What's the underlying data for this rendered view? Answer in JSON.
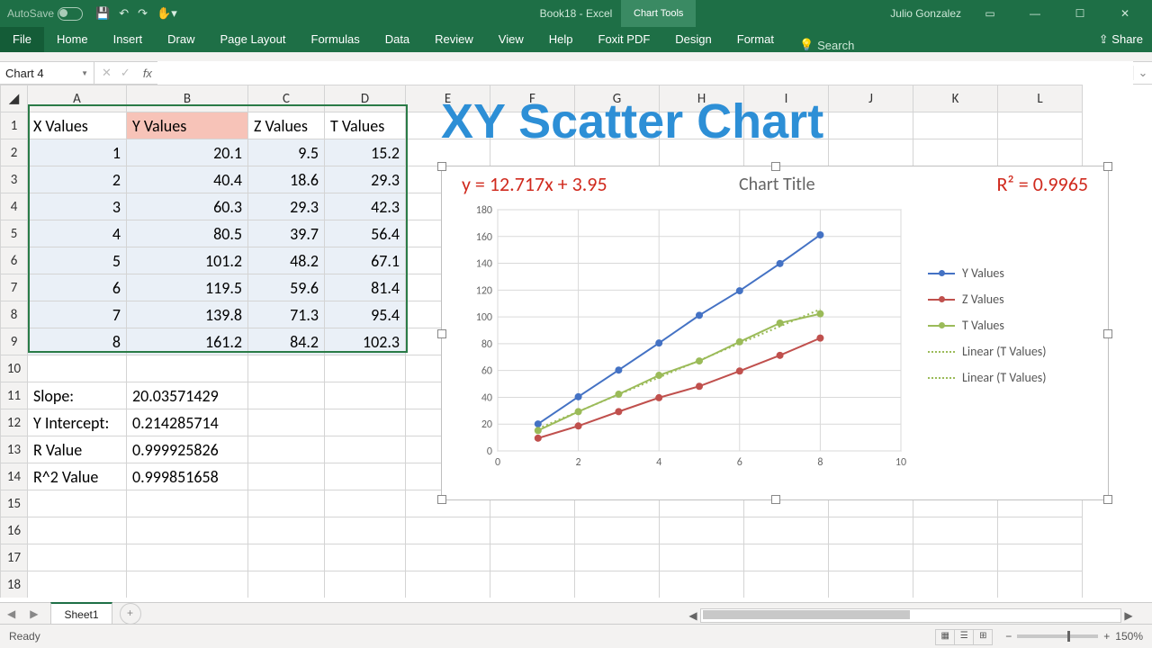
{
  "titlebar": {
    "autosave": "AutoSave",
    "doc": "Book18 - Excel",
    "tools": "Chart Tools",
    "user": "Julio Gonzalez"
  },
  "ribbon": {
    "tabs": [
      "File",
      "Home",
      "Insert",
      "Draw",
      "Page Layout",
      "Formulas",
      "Data",
      "Review",
      "View",
      "Help",
      "Foxit PDF",
      "Design",
      "Format"
    ],
    "search": "Search",
    "share": "Share"
  },
  "namebox": "Chart 4",
  "columns": [
    "A",
    "B",
    "C",
    "D",
    "E",
    "F",
    "G",
    "H",
    "I",
    "J",
    "K",
    "L"
  ],
  "headers": {
    "A": "X Values",
    "B": "Y Values",
    "C": "Z Values",
    "D": "T Values"
  },
  "rows": [
    {
      "A": "1",
      "B": "20.1",
      "C": "9.5",
      "D": "15.2"
    },
    {
      "A": "2",
      "B": "40.4",
      "C": "18.6",
      "D": "29.3"
    },
    {
      "A": "3",
      "B": "60.3",
      "C": "29.3",
      "D": "42.3"
    },
    {
      "A": "4",
      "B": "80.5",
      "C": "39.7",
      "D": "56.4"
    },
    {
      "A": "5",
      "B": "101.2",
      "C": "48.2",
      "D": "67.1"
    },
    {
      "A": "6",
      "B": "119.5",
      "C": "59.6",
      "D": "81.4"
    },
    {
      "A": "7",
      "B": "139.8",
      "C": "71.3",
      "D": "95.4"
    },
    {
      "A": "8",
      "B": "161.2",
      "C": "84.2",
      "D": "102.3"
    }
  ],
  "stats": [
    {
      "label": "Slope:",
      "value": "20.03571429"
    },
    {
      "label": "Y Intercept:",
      "value": "0.214285714"
    },
    {
      "label": "R Value",
      "value": "0.999925826"
    },
    {
      "label": "R^2 Value",
      "value": "0.999851658"
    }
  ],
  "big_title": "XY Scatter Chart",
  "chart_overlay": {
    "equation": "y = 12.717x + 3.95",
    "title": "Chart Title",
    "r2": "R² = 0.9965"
  },
  "legend": [
    "Y Values",
    "Z Values",
    "T Values",
    "Linear (T Values)",
    "Linear (T Values)"
  ],
  "sheet_tab": "Sheet1",
  "status": {
    "ready": "Ready",
    "zoom": "150%"
  },
  "chart_data": {
    "type": "scatter",
    "title": "Chart Title",
    "xlabel": "",
    "ylabel": "",
    "xlim": [
      0,
      10
    ],
    "ylim": [
      0,
      180
    ],
    "xticks": [
      0,
      2,
      4,
      6,
      8,
      10
    ],
    "yticks": [
      0,
      20,
      40,
      60,
      80,
      100,
      120,
      140,
      160,
      180
    ],
    "x": [
      1,
      2,
      3,
      4,
      5,
      6,
      7,
      8
    ],
    "series": [
      {
        "name": "Y Values",
        "color": "#4472c4",
        "values": [
          20.1,
          40.4,
          60.3,
          80.5,
          101.2,
          119.5,
          139.8,
          161.2
        ]
      },
      {
        "name": "Z Values",
        "color": "#c0504d",
        "values": [
          9.5,
          18.6,
          29.3,
          39.7,
          48.2,
          59.6,
          71.3,
          84.2
        ]
      },
      {
        "name": "T Values",
        "color": "#9bbb59",
        "values": [
          15.2,
          29.3,
          42.3,
          56.4,
          67.1,
          81.4,
          95.4,
          102.3
        ]
      }
    ],
    "trendlines": [
      {
        "name": "Linear (T Values)",
        "color": "#9bbb59",
        "slope": 12.717,
        "intercept": 3.95,
        "r2": 0.9965
      }
    ]
  }
}
